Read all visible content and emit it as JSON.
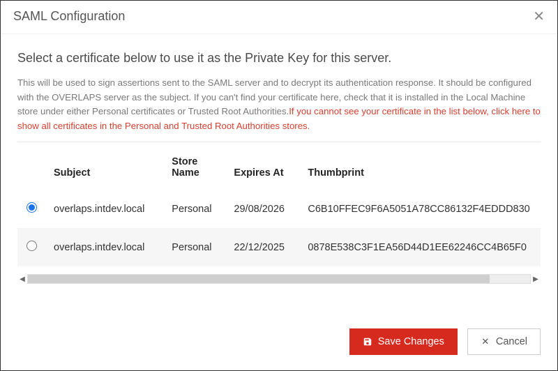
{
  "header": {
    "title": "SAML Configuration"
  },
  "body": {
    "subheading": "Select a certificate below to use it as the Private Key for this server.",
    "description_plain": "This will be used to sign assertions sent to the SAML server and to decrypt its authentication response. It should be configured with the OVERLAPS server as the subject. If you can't find your certificate here, check that it is installed in the Local Machine store under either Personal certificates or Trusted Root Authorities.",
    "description_warn": "If you cannot see your certificate in the list below, click here to show all certificates in the Personal and Trusted Root Authorities stores.",
    "columns": {
      "subject": "Subject",
      "store_name": "Store Name",
      "expires_at": "Expires At",
      "thumbprint": "Thumbprint"
    },
    "rows": [
      {
        "selected": true,
        "subject": "overlaps.intdev.local",
        "store_name": "Personal",
        "expires_at": "29/08/2026",
        "thumbprint": "C6B10FFEC9F6A5051A78CC86132F4EDDD830"
      },
      {
        "selected": false,
        "subject": "overlaps.intdev.local",
        "store_name": "Personal",
        "expires_at": "22/12/2025",
        "thumbprint": "0878E538C3F1EA56D44D1EE62246CC4B65F0"
      }
    ]
  },
  "footer": {
    "save_label": "Save Changes",
    "cancel_label": "Cancel"
  },
  "colors": {
    "primary": "#d62a1f",
    "warn_text": "#d63f2e"
  }
}
